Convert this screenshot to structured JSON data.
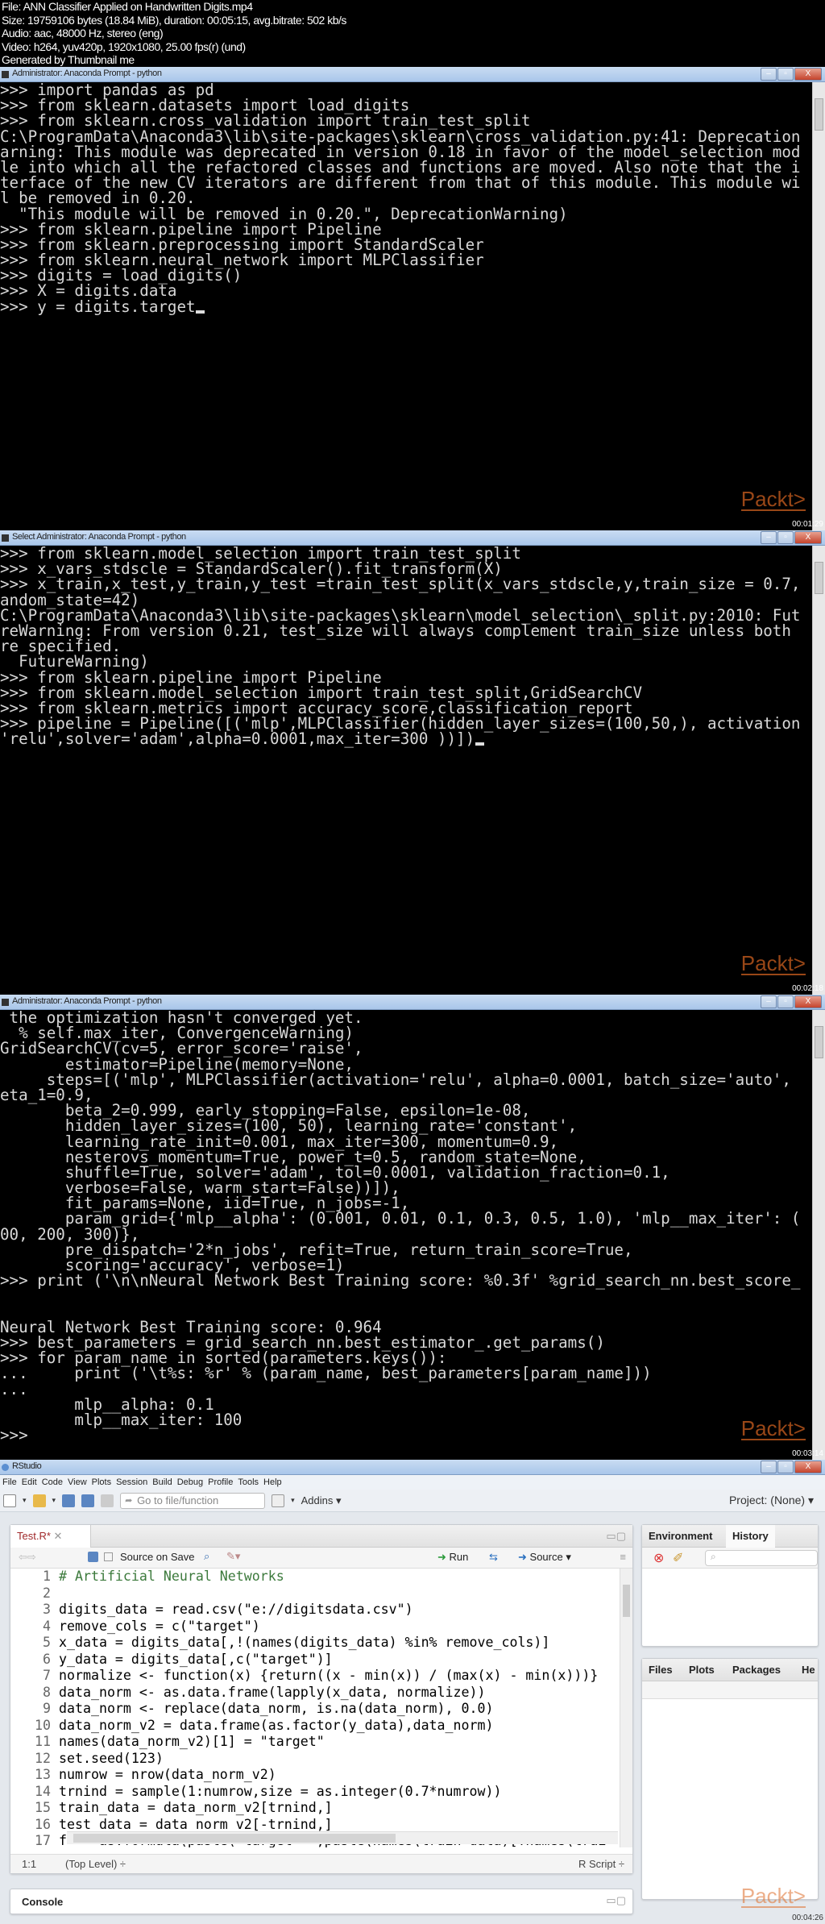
{
  "header": {
    "lines": [
      "File: ANN Classifier Applied on Handwritten Digits.mp4",
      "Size: 19759106 bytes (18.84 MiB), duration: 00:05:15, avg.bitrate: 502 kb/s",
      "Audio: aac, 48000 Hz, stereo (eng)",
      "Video: h264, yuv420p, 1920x1080, 25.00 fps(r) (und)",
      "Generated by Thumbnail me"
    ]
  },
  "frames": [
    {
      "title": "Administrator: Anaconda Prompt - python",
      "timestamp": "00:01:29",
      "watermark": "Packt>",
      "lines": [
        ">>> import pandas as pd",
        ">>> from sklearn.datasets import load_digits",
        ">>> from sklearn.cross_validation import train_test_split",
        "C:\\ProgramData\\Anaconda3\\lib\\site-packages\\sklearn\\cross_validation.py:41: Deprecation",
        "arning: This module was deprecated in version 0.18 in favor of the model_selection mod",
        "le into which all the refactored classes and functions are moved. Also note that the i",
        "terface of the new CV iterators are different from that of this module. This module wi",
        "l be removed in 0.20.",
        "  \"This module will be removed in 0.20.\", DeprecationWarning)",
        ">>> from sklearn.pipeline import Pipeline",
        ">>> from sklearn.preprocessing import StandardScaler",
        ">>> from sklearn.neural_network import MLPClassifier",
        ">>> digits = load_digits()",
        ">>> X = digits.data",
        ">>> y = digits.target"
      ]
    },
    {
      "title": "Select Administrator: Anaconda Prompt - python",
      "timestamp": "00:02:18",
      "watermark": "Packt>",
      "lines": [
        ">>> from sklearn.model_selection import train_test_split",
        ">>> x_vars_stdscle = StandardScaler().fit_transform(X)",
        ">>> x_train,x_test,y_train,y_test =train_test_split(x_vars_stdscle,y,train_size = 0.7,",
        "andom_state=42)",
        "C:\\ProgramData\\Anaconda3\\lib\\site-packages\\sklearn\\model_selection\\_split.py:2010: Fut",
        "reWarning: From version 0.21, test_size will always complement train_size unless both",
        "re specified.",
        "  FutureWarning)",
        ">>> from sklearn.pipeline import Pipeline",
        ">>> from sklearn.model_selection import train_test_split,GridSearchCV",
        ">>> from sklearn.metrics import accuracy_score,classification_report",
        ">>> pipeline = Pipeline([('mlp',MLPClassifier(hidden_layer_sizes=(100,50,), activation",
        "'relu',solver='adam',alpha=0.0001,max_iter=300 ))])"
      ]
    },
    {
      "title": "Administrator: Anaconda Prompt - python",
      "timestamp": "00:03:14",
      "watermark": "Packt>",
      "lines": [
        " the optimization hasn't converged yet.",
        "  % self.max_iter, ConvergenceWarning)",
        "GridSearchCV(cv=5, error_score='raise',",
        "       estimator=Pipeline(memory=None,",
        "     steps=[('mlp', MLPClassifier(activation='relu', alpha=0.0001, batch_size='auto',",
        "eta_1=0.9,",
        "       beta_2=0.999, early_stopping=False, epsilon=1e-08,",
        "       hidden_layer_sizes=(100, 50), learning_rate='constant',",
        "       learning_rate_init=0.001, max_iter=300, momentum=0.9,",
        "       nesterovs_momentum=True, power_t=0.5, random_state=None,",
        "       shuffle=True, solver='adam', tol=0.0001, validation_fraction=0.1,",
        "       verbose=False, warm_start=False))]),",
        "       fit_params=None, iid=True, n_jobs=-1,",
        "       param_grid={'mlp__alpha': (0.001, 0.01, 0.1, 0.3, 0.5, 1.0), 'mlp__max_iter': (",
        "00, 200, 300)},",
        "       pre_dispatch='2*n_jobs', refit=True, return_train_score=True,",
        "       scoring='accuracy', verbose=1)",
        ">>> print ('\\n\\nNeural Network Best Training score: %0.3f' %grid_search_nn.best_score_",
        "",
        "",
        "Neural Network Best Training score: 0.964",
        ">>> best_parameters = grid_search_nn.best_estimator_.get_params()",
        ">>> for param_name in sorted(parameters.keys()):",
        "...     print ('\\t%s: %r' % (param_name, best_parameters[param_name]))",
        "...",
        "        mlp__alpha: 0.1",
        "        mlp__max_iter: 100",
        ">>>"
      ]
    }
  ],
  "rstudio": {
    "title": "RStudio",
    "timestamp": "00:04:26",
    "watermark": "Packt>",
    "menu": [
      "File",
      "Edit",
      "Code",
      "View",
      "Plots",
      "Session",
      "Build",
      "Debug",
      "Profile",
      "Tools",
      "Help"
    ],
    "goto_placeholder": "Go to file/function",
    "addins": "Addins ▾",
    "project": "Project: (None) ▾",
    "editor_tab": "Test.R*",
    "source_on_save": "Source on Save",
    "run": "Run",
    "source": "Source ▾",
    "code": [
      "# Artificial Neural Networks",
      "",
      "digits_data = read.csv(\"e://digitsdata.csv\")",
      "remove_cols = c(\"target\")",
      "x_data = digits_data[,!(names(digits_data) %in% remove_cols)]",
      "y_data = digits_data[,c(\"target\")]",
      "normalize <- function(x) {return((x - min(x)) / (max(x) - min(x)))}",
      "data_norm <- as.data.frame(lapply(x_data, normalize))",
      "data_norm <- replace(data_norm, is.na(data_norm), 0.0)",
      "data_norm_v2 = data.frame(as.factor(y_data),data_norm)",
      "names(data_norm_v2)[1] = \"target\"",
      "set.seed(123)",
      "numrow = nrow(data_norm_v2)",
      "trnind = sample(1:numrow,size = as.integer(0.7*numrow))",
      "train_data = data_norm_v2[trnind,]",
      "test_data = data_norm_v2[-trnind,]",
      "f <- as.formula(paste(\"target ~\",paste(names(train_data)[!names(trai",
      ""
    ],
    "cursor_pos": "1:1",
    "scope": "(Top Level) ÷",
    "file_type": "R Script ÷",
    "console_label": "Console",
    "env_tabs": [
      "Environment",
      "History"
    ],
    "files_tabs": [
      "Files",
      "Plots",
      "Packages",
      "He"
    ]
  }
}
